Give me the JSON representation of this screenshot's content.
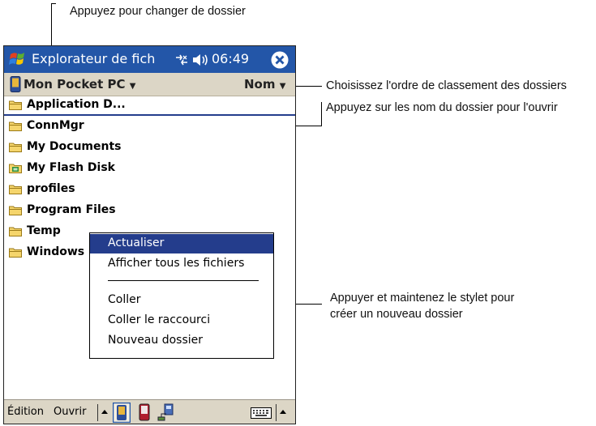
{
  "callouts": {
    "folder_switch": "Appuyez pour changer de dossier",
    "sort_order": "Choisissez l'ordre de classement des dossiers",
    "open_folder": "Appuyez sur les nom du dossier pour l'ouvrir",
    "new_folder_line1": "Appuyer et maintenez le stylet pour",
    "new_folder_line2": "créer un nouveau dossier"
  },
  "titlebar": {
    "title": "Explorateur de fich",
    "time": "06:49",
    "start_icon": "windows-flag-icon",
    "connectivity_icon": "connectivity-icon",
    "volume_icon": "speaker-icon",
    "close_icon": "close-icon"
  },
  "location": {
    "folder": "Mon Pocket PC",
    "sort": "Nom"
  },
  "files": [
    {
      "name": "Application D...",
      "icon": "folder-icon"
    },
    {
      "name": "ConnMgr",
      "icon": "folder-icon"
    },
    {
      "name": "My Documents",
      "icon": "folder-icon"
    },
    {
      "name": "My Flash Disk",
      "icon": "storage-card-icon"
    },
    {
      "name": "profiles",
      "icon": "folder-icon"
    },
    {
      "name": "Program Files",
      "icon": "folder-icon"
    },
    {
      "name": "Temp",
      "icon": "folder-icon"
    },
    {
      "name": "Windows",
      "icon": "folder-icon"
    }
  ],
  "context_menu": {
    "items": [
      "Actualiser",
      "Afficher tous les fichiers",
      "Coller",
      "Coller le raccourci",
      "Nouveau dossier"
    ]
  },
  "bottombar": {
    "edit": "Édition",
    "open": "Ouvrir"
  },
  "colors": {
    "titlebar": "#2356a8",
    "bars": "#dcd6c6",
    "selection": "#243d8c"
  }
}
